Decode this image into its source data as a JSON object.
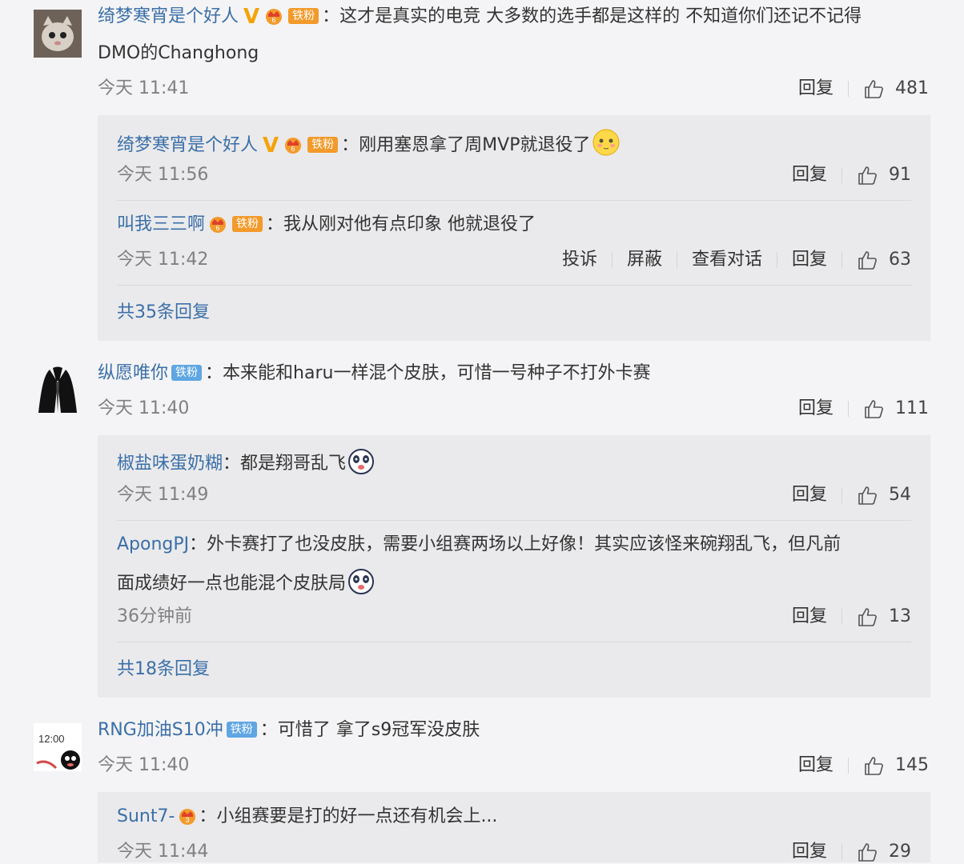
{
  "comments": [
    {
      "user": "绮梦寒宵是个好人",
      "badge": "V",
      "fan_badge": "铁粉",
      "text_line1": "这才是真实的电竞 大多数的选手都是这样的 不知道你们还记不记得",
      "text_line2": "DMO的Changhong",
      "time": "今天 11:41",
      "reply_label": "回复",
      "likes": "481",
      "replies": [
        {
          "user": "绮梦寒宵是个好人",
          "badge": "V",
          "fan_badge": "铁粉",
          "text": "刚用塞恩拿了周MVP就退役了",
          "time": "今天 11:56",
          "reply_label": "回复",
          "likes": "91"
        },
        {
          "user": "叫我三三啊",
          "fan_badge": "铁粉",
          "text": "我从刚对他有点印象 他就退役了",
          "time": "今天 11:42",
          "report_label": "投诉",
          "block_label": "屏蔽",
          "convo_label": "查看对话",
          "reply_label": "回复",
          "likes": "63"
        }
      ],
      "more_replies": "共35条回复"
    },
    {
      "user": "纵愿唯你",
      "fan_badge": "铁粉",
      "text_line1": "本来能和haru一样混个皮肤，可惜一号种子不打外卡赛",
      "time": "今天 11:40",
      "reply_label": "回复",
      "likes": "111",
      "replies": [
        {
          "user": "椒盐味蛋奶糊",
          "text": "都是翔哥乱飞",
          "time": "今天 11:49",
          "reply_label": "回复",
          "likes": "54"
        },
        {
          "user": "ApongPJ",
          "text_line1": "外卡赛打了也没皮肤，需要小组赛两场以上好像！其实应该怪来碗翔乱飞，但凡前",
          "text_line2": "面成绩好一点也能混个皮肤局",
          "time": "36分钟前",
          "reply_label": "回复",
          "likes": "13"
        }
      ],
      "more_replies": "共18条回复"
    },
    {
      "user": "RNG加油S10冲",
      "fan_badge": "铁粉",
      "avatar_text": "12:00",
      "text_line1": "可惜了 拿了s9冠军没皮肤",
      "time": "今天 11:40",
      "reply_label": "回复",
      "likes": "145",
      "replies": [
        {
          "user": "Sunt7-",
          "text": "小组赛要是打的好一点还有机会上...",
          "time": "今天 11:44",
          "reply_label": "回复",
          "likes": "29"
        }
      ]
    }
  ],
  "colors": {
    "link": "#3b6fa8",
    "fan_badge": "#5fa6e3",
    "vip": "#f4a30b"
  },
  "icons": {
    "like": "thumbs-up-icon",
    "crown": "crown-badge-icon",
    "emoji_blush": "blush-emoji-icon",
    "emoji_panda": "panda-emoji-icon"
  }
}
